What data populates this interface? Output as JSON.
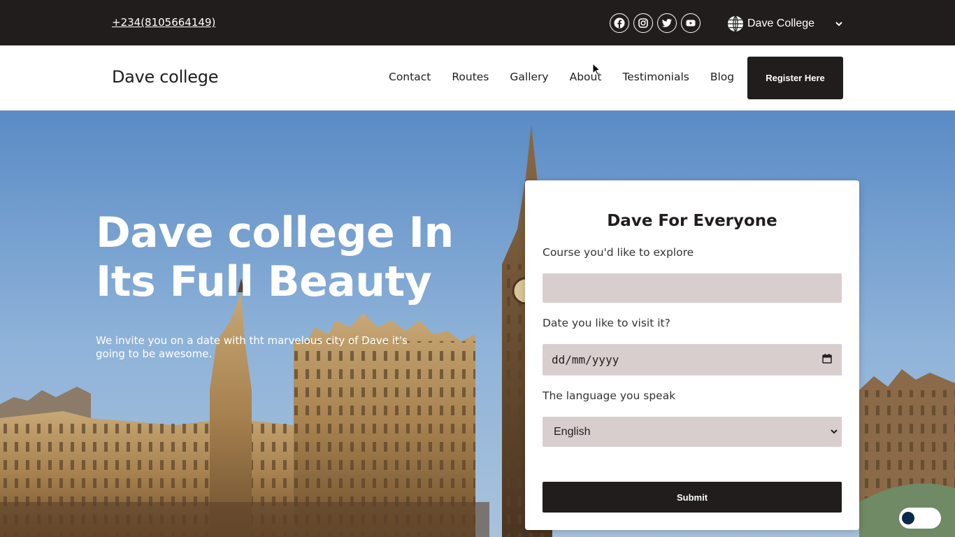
{
  "topbar": {
    "phone": "+234(8105664149)",
    "socials": [
      {
        "icon": "facebook-icon"
      },
      {
        "icon": "instagram-icon"
      },
      {
        "icon": "twitter-icon"
      },
      {
        "icon": "youtube-icon"
      }
    ],
    "language_select": "Dave College"
  },
  "nav": {
    "brand": "Dave college",
    "links": [
      "Contact",
      "Routes",
      "Gallery",
      "About",
      "Testimonials",
      "Blog"
    ],
    "register_label": "Register Here"
  },
  "hero": {
    "title": "Dave college In Its Full Beauty",
    "subtitle": "We invite you on a date with tht marvelous city of Dave it's going to be awesome."
  },
  "form": {
    "title": "Dave For Everyone",
    "course_label": "Course you'd like to explore",
    "course_value": "",
    "date_label": "Date you like to visit it?",
    "date_placeholder": "dd/mm/yyyy",
    "language_label": "The language you speak",
    "language_value": "English",
    "submit_label": "Submit"
  },
  "colors": {
    "dark": "#221d1d",
    "field_bg": "#d9cece",
    "toggle_knob": "#0b2a4a"
  }
}
